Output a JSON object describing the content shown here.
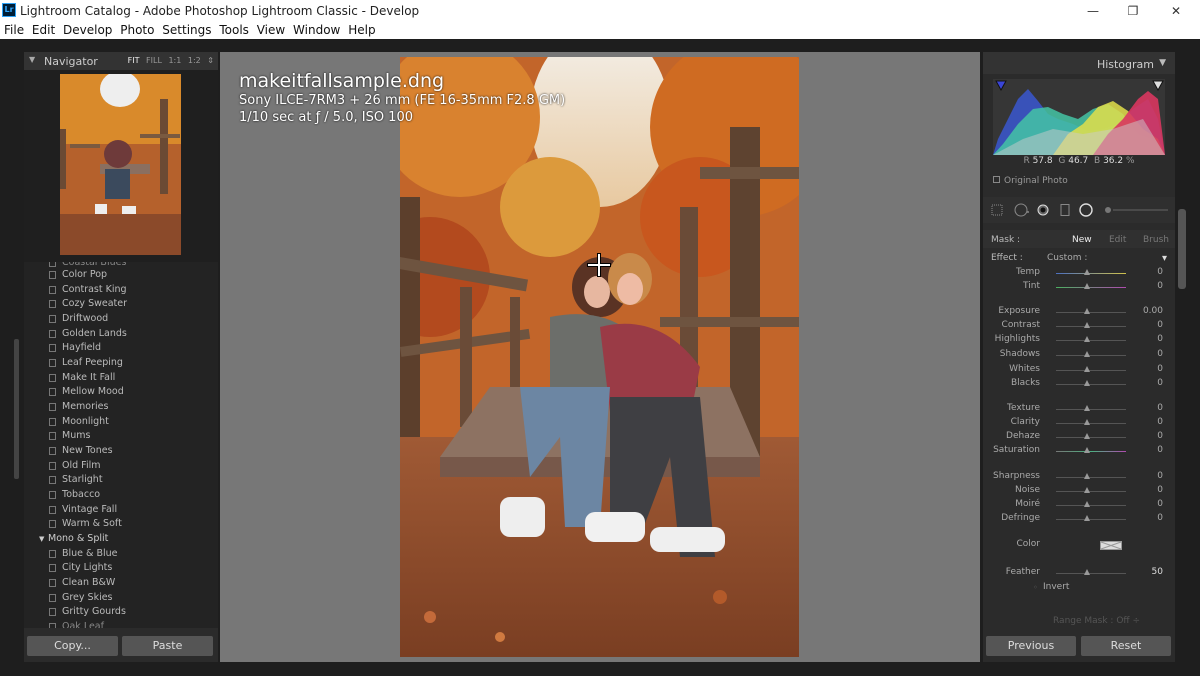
{
  "window": {
    "app_icon": "Lr",
    "title": "Lightroom Catalog - Adobe Photoshop Lightroom Classic - Develop",
    "minimize": "—",
    "maximize": "❐",
    "close": "✕"
  },
  "menu": [
    "File",
    "Edit",
    "Develop",
    "Photo",
    "Settings",
    "Tools",
    "View",
    "Window",
    "Help"
  ],
  "navigator": {
    "title": "Navigator",
    "zoom_options": [
      "FIT",
      "FILL",
      "1:1",
      "1:2"
    ],
    "zoom_more": "⇕",
    "active_zoom": "FIT"
  },
  "presets": {
    "partial_top": "Coastal Blues",
    "items": [
      "Color Pop",
      "Contrast King",
      "Cozy Sweater",
      "Driftwood",
      "Golden Lands",
      "Hayfield",
      "Leaf Peeping",
      "Make It Fall",
      "Mellow Mood",
      "Memories",
      "Moonlight",
      "Mums",
      "New Tones",
      "Old Film",
      "Starlight",
      "Tobacco",
      "Vintage Fall",
      "Warm & Soft"
    ],
    "group": "Mono & Split",
    "group_items": [
      "Blue & Blue",
      "City Lights",
      "Clean B&W",
      "Grey Skies",
      "Gritty Gourds"
    ],
    "partial_bottom": "Oak Leaf"
  },
  "left_buttons": {
    "copy": "Copy...",
    "paste": "Paste"
  },
  "photo_info": {
    "filename": "makeitfallsample.dng",
    "camera": "Sony ILCE-7RM3 + 26 mm (FE 16-35mm F2.8 GM)",
    "exposure": "1/10 sec at ƒ / 5.0, ISO 100"
  },
  "histogram": {
    "title": "Histogram",
    "r_label": "R",
    "r_value": "57.8",
    "g_label": "G",
    "g_value": "46.7",
    "b_label": "B",
    "b_value": "36.2",
    "percent": "%",
    "original_photo": "Original Photo"
  },
  "mask": {
    "label": "Mask :",
    "new": "New",
    "edit": "Edit",
    "brush": "Brush"
  },
  "effect": {
    "label": "Effect :",
    "value": "Custom :",
    "dropdown": "▾"
  },
  "adjustments": [
    {
      "label": "Temp",
      "value": "0"
    },
    {
      "label": "Tint",
      "value": "0"
    },
    {
      "label": "Exposure",
      "value": "0.00"
    },
    {
      "label": "Contrast",
      "value": "0"
    },
    {
      "label": "Highlights",
      "value": "0"
    },
    {
      "label": "Shadows",
      "value": "0"
    },
    {
      "label": "Whites",
      "value": "0"
    },
    {
      "label": "Blacks",
      "value": "0"
    },
    {
      "label": "Texture",
      "value": "0"
    },
    {
      "label": "Clarity",
      "value": "0"
    },
    {
      "label": "Dehaze",
      "value": "0"
    },
    {
      "label": "Saturation",
      "value": "0"
    },
    {
      "label": "Sharpness",
      "value": "0"
    },
    {
      "label": "Noise",
      "value": "0"
    },
    {
      "label": "Moiré",
      "value": "0"
    },
    {
      "label": "Defringe",
      "value": "0"
    }
  ],
  "color_label": "Color",
  "feather": {
    "label": "Feather",
    "value": "50"
  },
  "invert": "Invert",
  "range_mask": "Range Mask : Off ÷",
  "right_buttons": {
    "previous": "Previous",
    "reset": "Reset"
  }
}
